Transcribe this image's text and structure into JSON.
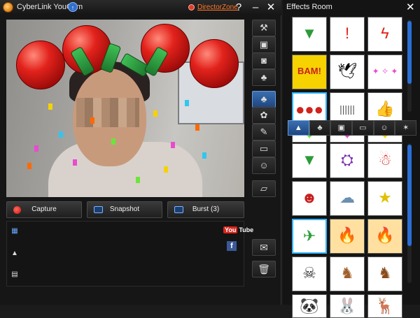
{
  "main": {
    "title": "CyberLink YouCam",
    "director_zone": "DirectorZone",
    "help": "?",
    "minimize": "–",
    "close": "✕"
  },
  "capture": {
    "capture_label": "Capture",
    "snapshot_label": "Snapshot",
    "burst_label": "Burst (3)"
  },
  "share": {
    "youtube_you": "You",
    "youtube_tube": "Tube",
    "facebook": "f"
  },
  "effects": {
    "title": "Effects Room",
    "close": "✕",
    "tabs": [
      {
        "icon": "wizard-hat-icon",
        "glyph": "▲"
      },
      {
        "icon": "avatar-icon",
        "glyph": "♣"
      },
      {
        "icon": "frame-icon",
        "glyph": "▣"
      },
      {
        "icon": "screen-icon",
        "glyph": "▭"
      },
      {
        "icon": "emotion-icon",
        "glyph": "☺"
      },
      {
        "icon": "magic-wand-icon",
        "glyph": "✶"
      }
    ]
  },
  "colors": {
    "accent": "#2b6fd6",
    "director_zone": "#ff7a2a",
    "record": "#d01010"
  }
}
